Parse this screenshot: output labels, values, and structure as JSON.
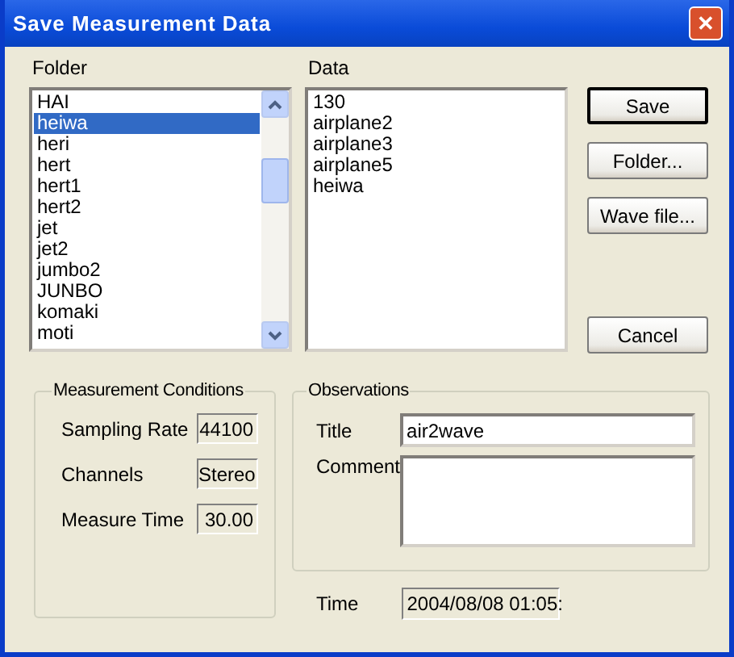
{
  "window": {
    "title": "Save Measurement Data",
    "close": "✕"
  },
  "folder": {
    "label": "Folder",
    "items": [
      {
        "label": "HAI",
        "selected": false
      },
      {
        "label": "heiwa",
        "selected": true
      },
      {
        "label": "heri",
        "selected": false
      },
      {
        "label": "hert",
        "selected": false
      },
      {
        "label": "hert1",
        "selected": false
      },
      {
        "label": "hert2",
        "selected": false
      },
      {
        "label": "jet",
        "selected": false
      },
      {
        "label": "jet2",
        "selected": false
      },
      {
        "label": "jumbo2",
        "selected": false
      },
      {
        "label": "JUNBO",
        "selected": false
      },
      {
        "label": "komaki",
        "selected": false
      },
      {
        "label": "moti",
        "selected": false
      }
    ]
  },
  "data": {
    "label": "Data",
    "items": [
      "130",
      "airplane2",
      "airplane3",
      "airplane5",
      "heiwa"
    ]
  },
  "buttons": [
    {
      "label": "Save",
      "default": true
    },
    {
      "label": "Folder...",
      "default": false
    },
    {
      "label": "Wave file...",
      "default": false
    },
    {
      "label": "Cancel",
      "default": false
    }
  ],
  "conditions": {
    "title": "Measurement Conditions",
    "rows": [
      {
        "label": "Sampling Rate",
        "value": "44100"
      },
      {
        "label": "Channels",
        "value": "Stereo"
      },
      {
        "label": "Measure Time",
        "value": "30.00"
      }
    ]
  },
  "observations": {
    "title": "Observations",
    "title_label": "Title",
    "title_value": "air2wave",
    "comment_label": "Comment"
  },
  "time": {
    "label": "Time",
    "value": "2004/08/08 01:05:"
  }
}
